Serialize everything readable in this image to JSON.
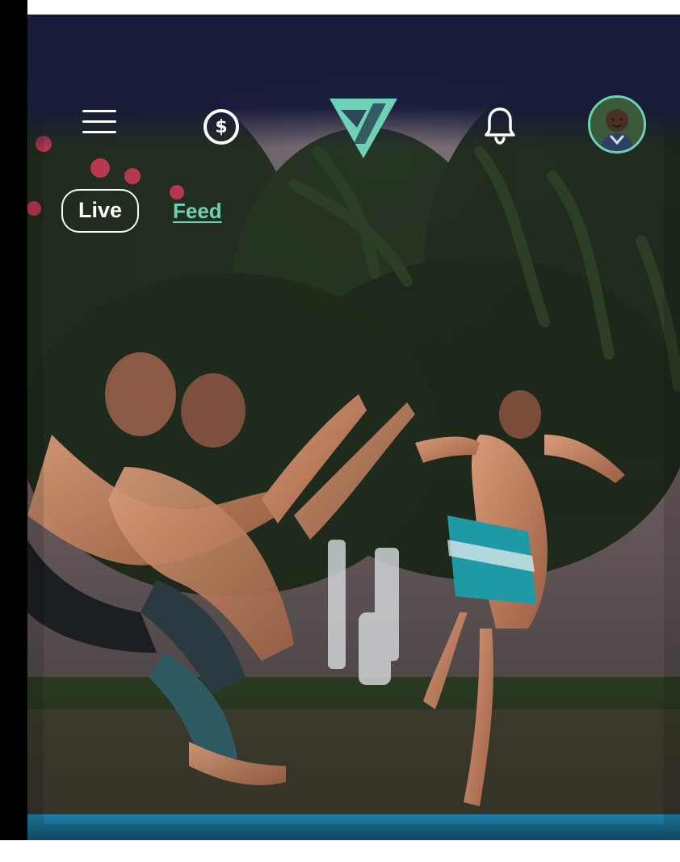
{
  "header": {
    "menu_icon": "hamburger-menu-icon",
    "wallet_icon": "dollar-circle-icon",
    "logo_icon": "triangle-brand-logo",
    "notifications_icon": "bell-icon",
    "avatar_icon": "user-avatar"
  },
  "tabs": [
    {
      "label": "Live",
      "active": true
    },
    {
      "label": "Feed",
      "active": false
    }
  ],
  "colors": {
    "accent": "#6cd1b5",
    "header_bg": "#181b3a",
    "text": "#ffffff"
  }
}
